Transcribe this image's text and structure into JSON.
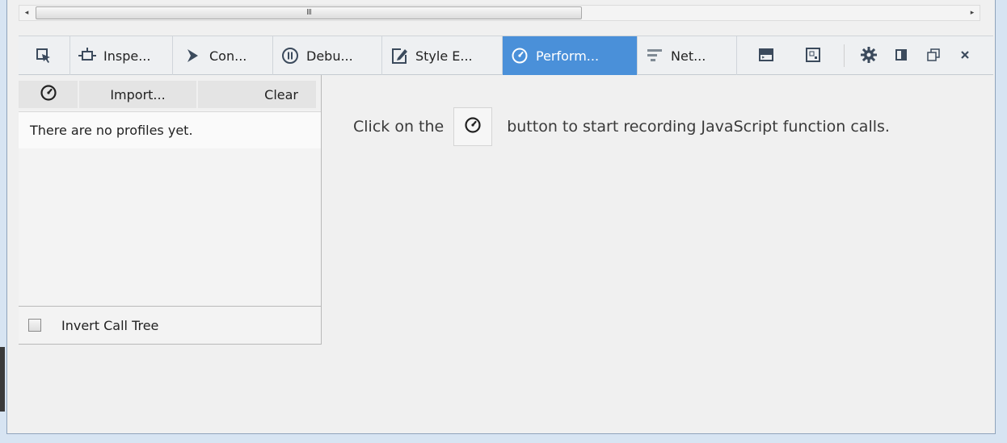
{
  "scrollbar": {
    "left_arrow": "◂",
    "right_arrow": "▸",
    "grip": "III"
  },
  "toolbar": {
    "tabs": [
      {
        "label": "Inspe...",
        "icon": "inspector-icon"
      },
      {
        "label": "Con...",
        "icon": "console-icon"
      },
      {
        "label": "Debu...",
        "icon": "debugger-icon"
      },
      {
        "label": "Style E...",
        "icon": "style-editor-icon"
      },
      {
        "label": "Perform...",
        "icon": "performance-icon",
        "active": true
      },
      {
        "label": "Net...",
        "icon": "network-icon"
      }
    ],
    "accent": "#4a90d9"
  },
  "sidebar": {
    "import_label": "Import...",
    "clear_label": "Clear",
    "empty_text": "There are no profiles yet.",
    "invert_label": "Invert Call Tree"
  },
  "main": {
    "message_before": "Click on the",
    "message_after": "button to start recording JavaScript function calls."
  }
}
